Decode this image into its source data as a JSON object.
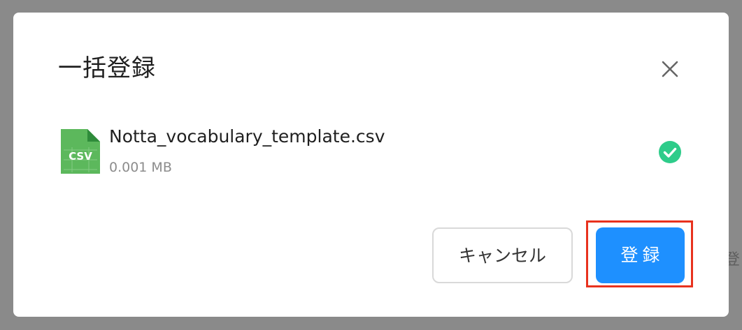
{
  "background": {
    "partial_text": "登"
  },
  "dialog": {
    "title": "一括登録",
    "close_icon": "close-icon"
  },
  "file": {
    "icon": "csv-file-icon",
    "icon_label": "CSV",
    "name": "Notta_vocabulary_template.csv",
    "size": "0.001 MB",
    "status_icon": "check-circle-icon"
  },
  "footer": {
    "cancel_label": "キャンセル",
    "register_label": "登録"
  },
  "colors": {
    "primary": "#1e90ff",
    "success": "#2ecc8a",
    "csv_green": "#5cb85c",
    "highlight": "#e8321e"
  }
}
